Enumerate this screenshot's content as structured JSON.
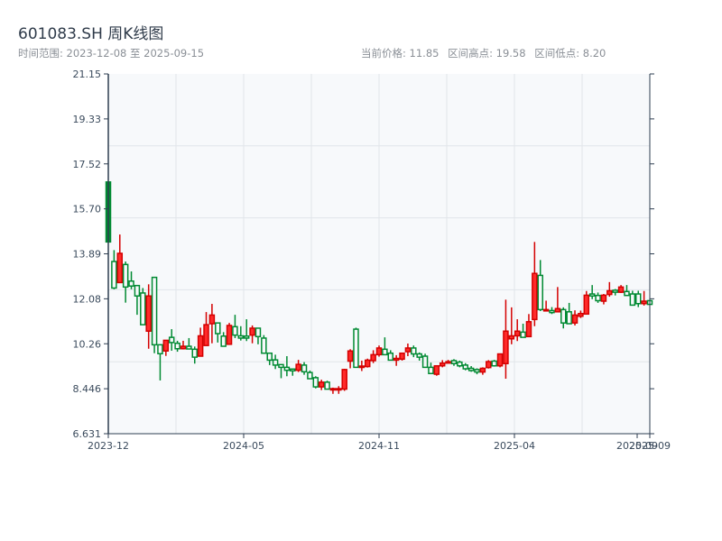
{
  "header": {
    "title": "601083.SH 周K线图",
    "range": "时间范围: 2023-12-08 至 2025-09-15",
    "current_price": "当前价格: 11.85",
    "range_high": "区间高点: 19.58",
    "range_low": "区间低点: 8.20"
  },
  "colors": {
    "up": "#ff2a2a",
    "up_border": "#d40000",
    "down": "#008a32",
    "plot_bg": "#f7f9fb",
    "grid": "#e1e5ea",
    "axis": "#2e3e50"
  },
  "chart_data": {
    "type": "candlestick",
    "title": "601083.SH 周K线图",
    "ylim": [
      6.631,
      21.15
    ],
    "yticks": [
      "21.15",
      "19.33",
      "17.52",
      "15.70",
      "13.89",
      "12.08",
      "10.26",
      "8.446",
      "6.631"
    ],
    "xticks": [
      "2023-12",
      "2024-05",
      "2024-11",
      "2025-04",
      "2025-09",
      "2025-09"
    ],
    "grid": true,
    "ohlc_fields": [
      "open",
      "high",
      "low",
      "close"
    ],
    "candles": [
      [
        16.79,
        16.79,
        14.37,
        14.37
      ],
      [
        13.58,
        14.04,
        12.46,
        12.51
      ],
      [
        12.73,
        14.67,
        12.73,
        13.91
      ],
      [
        13.46,
        13.58,
        11.92,
        12.55
      ],
      [
        12.79,
        13.18,
        12.46,
        12.59
      ],
      [
        12.61,
        12.61,
        11.43,
        12.19
      ],
      [
        12.31,
        12.51,
        11.03,
        11.03
      ],
      [
        10.77,
        12.66,
        10.06,
        12.19
      ],
      [
        12.94,
        12.94,
        9.88,
        10.22
      ],
      [
        10.22,
        10.22,
        8.78,
        9.86
      ],
      [
        9.97,
        10.4,
        9.77,
        10.4
      ],
      [
        10.52,
        10.85,
        9.98,
        10.31
      ],
      [
        10.28,
        10.38,
        9.94,
        10.06
      ],
      [
        10.06,
        10.38,
        10.03,
        10.16
      ],
      [
        10.16,
        10.49,
        10.05,
        10.05
      ],
      [
        10.04,
        10.15,
        9.46,
        9.72
      ],
      [
        9.76,
        10.91,
        9.76,
        10.58
      ],
      [
        10.19,
        11.54,
        10.19,
        11.03
      ],
      [
        11.07,
        11.87,
        10.28,
        11.42
      ],
      [
        11.1,
        11.1,
        10.31,
        10.67
      ],
      [
        10.57,
        10.73,
        10.16,
        10.16
      ],
      [
        10.24,
        11.1,
        10.24,
        11.0
      ],
      [
        10.95,
        11.43,
        10.49,
        10.61
      ],
      [
        10.58,
        10.97,
        10.39,
        10.49
      ],
      [
        10.57,
        11.25,
        10.37,
        10.49
      ],
      [
        10.61,
        11.0,
        10.28,
        10.89
      ],
      [
        10.89,
        10.89,
        10.24,
        10.55
      ],
      [
        10.49,
        10.61,
        9.88,
        9.88
      ],
      [
        9.88,
        9.88,
        9.4,
        9.6
      ],
      [
        9.61,
        9.82,
        9.24,
        9.4
      ],
      [
        9.42,
        9.42,
        8.87,
        9.31
      ],
      [
        9.31,
        9.76,
        8.95,
        9.19
      ],
      [
        9.24,
        9.24,
        8.97,
        9.17
      ],
      [
        9.19,
        9.61,
        9.12,
        9.43
      ],
      [
        9.4,
        9.52,
        9.01,
        9.13
      ],
      [
        9.1,
        9.18,
        8.85,
        8.85
      ],
      [
        8.89,
        8.95,
        8.46,
        8.52
      ],
      [
        8.52,
        8.81,
        8.39,
        8.71
      ],
      [
        8.71,
        8.77,
        8.43,
        8.43
      ],
      [
        8.4,
        8.49,
        8.24,
        8.45
      ],
      [
        8.4,
        8.55,
        8.24,
        8.45
      ],
      [
        8.43,
        9.25,
        8.36,
        9.22
      ],
      [
        9.56,
        10.04,
        9.27,
        9.97
      ],
      [
        10.85,
        10.91,
        9.31,
        9.31
      ],
      [
        9.31,
        9.58,
        9.16,
        9.36
      ],
      [
        9.34,
        9.66,
        9.3,
        9.6
      ],
      [
        9.58,
        10.0,
        9.48,
        9.82
      ],
      [
        9.82,
        10.19,
        9.74,
        10.09
      ],
      [
        10.04,
        10.52,
        9.82,
        9.82
      ],
      [
        9.88,
        10.0,
        9.6,
        9.6
      ],
      [
        9.6,
        9.8,
        9.37,
        9.67
      ],
      [
        9.64,
        9.88,
        9.58,
        9.88
      ],
      [
        9.94,
        10.27,
        9.76,
        10.09
      ],
      [
        10.09,
        10.19,
        9.72,
        9.85
      ],
      [
        9.85,
        9.91,
        9.58,
        9.72
      ],
      [
        9.76,
        9.86,
        9.31,
        9.31
      ],
      [
        9.31,
        9.5,
        9.06,
        9.06
      ],
      [
        9.03,
        9.37,
        8.97,
        9.37
      ],
      [
        9.37,
        9.6,
        9.31,
        9.48
      ],
      [
        9.48,
        9.61,
        9.48,
        9.54
      ],
      [
        9.58,
        9.64,
        9.37,
        9.46
      ],
      [
        9.52,
        9.58,
        9.31,
        9.37
      ],
      [
        9.4,
        9.48,
        9.19,
        9.25
      ],
      [
        9.27,
        9.36,
        9.13,
        9.18
      ],
      [
        9.22,
        9.27,
        9.03,
        9.12
      ],
      [
        9.12,
        9.31,
        9.01,
        9.27
      ],
      [
        9.3,
        9.6,
        9.26,
        9.54
      ],
      [
        9.56,
        9.61,
        9.34,
        9.37
      ],
      [
        9.37,
        9.85,
        9.31,
        9.85
      ],
      [
        9.46,
        12.04,
        8.85,
        10.77
      ],
      [
        10.46,
        11.73,
        10.24,
        10.58
      ],
      [
        10.58,
        11.25,
        10.37,
        10.77
      ],
      [
        10.73,
        11.07,
        10.52,
        10.52
      ],
      [
        10.55,
        11.46,
        10.55,
        11.15
      ],
      [
        11.24,
        14.37,
        10.97,
        13.1
      ],
      [
        13.02,
        13.64,
        11.58,
        11.64
      ],
      [
        11.6,
        12.0,
        11.6,
        11.64
      ],
      [
        11.6,
        11.74,
        11.46,
        11.52
      ],
      [
        11.55,
        12.55,
        11.55,
        11.68
      ],
      [
        11.64,
        11.73,
        10.88,
        11.1
      ],
      [
        11.55,
        11.91,
        11.07,
        11.07
      ],
      [
        11.1,
        11.61,
        11.0,
        11.42
      ],
      [
        11.37,
        11.6,
        11.3,
        11.48
      ],
      [
        11.46,
        12.39,
        11.46,
        12.22
      ],
      [
        12.27,
        12.63,
        12.06,
        12.19
      ],
      [
        12.21,
        12.33,
        11.91,
        12.0
      ],
      [
        11.98,
        12.27,
        11.85,
        12.22
      ],
      [
        12.25,
        12.75,
        12.16,
        12.4
      ],
      [
        12.42,
        12.47,
        12.21,
        12.34
      ],
      [
        12.34,
        12.63,
        12.31,
        12.55
      ],
      [
        12.37,
        12.63,
        12.21,
        12.21
      ],
      [
        12.27,
        12.4,
        11.82,
        11.82
      ],
      [
        12.27,
        12.4,
        11.74,
        11.88
      ],
      [
        11.88,
        12.39,
        11.8,
        11.98
      ],
      [
        12.0,
        12.0,
        11.85,
        11.85
      ]
    ]
  }
}
